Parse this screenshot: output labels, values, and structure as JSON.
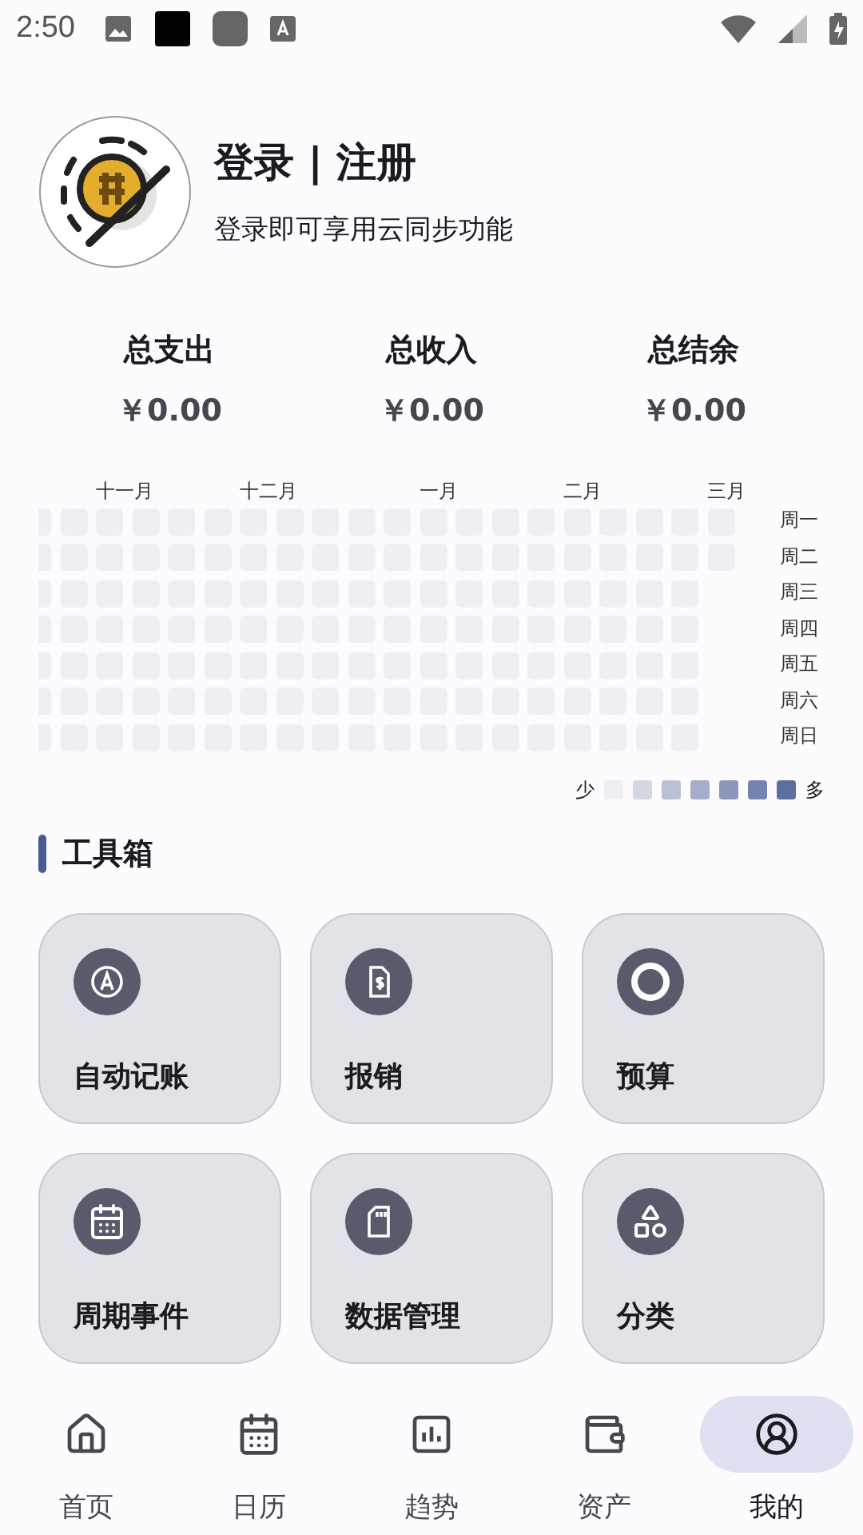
{
  "status_bar": {
    "time": "2:50"
  },
  "profile": {
    "title": "登录 | 注册",
    "subtitle": "登录即可享用云同步功能"
  },
  "totals": [
    {
      "label": "总支出",
      "value": "￥0.00"
    },
    {
      "label": "总收入",
      "value": "￥0.00"
    },
    {
      "label": "总结余",
      "value": "￥0.00"
    }
  ],
  "heatmap": {
    "weekdays": [
      "周一",
      "周二",
      "周三",
      "周四",
      "周五",
      "周六",
      "周日"
    ],
    "weeks": [
      {
        "days": [
          {
            "color": "#efeef4"
          },
          {
            "color": "#efeef4"
          },
          {
            "color": "#efeef4"
          },
          {
            "color": "#efeef4"
          },
          {
            "color": "#efeef4"
          },
          {
            "color": "#efeef4"
          },
          {
            "color": "#efeef4"
          }
        ]
      },
      {
        "days": [
          {
            "color": "#efeef4"
          },
          {
            "color": "#efeef4"
          },
          {
            "color": "#efeef4"
          },
          {
            "color": "#efeef4"
          },
          {
            "color": "#efeef4"
          },
          {
            "color": "#efeef4"
          },
          {
            "color": "#efeef4"
          }
        ]
      },
      {
        "month": "十一月",
        "days": [
          {
            "color": "#efeef4"
          },
          {
            "color": "#efeef4"
          },
          {
            "color": "#efeef4"
          },
          {
            "color": "#efeef4"
          },
          {
            "color": "#efeef4"
          },
          {
            "color": "#efeef4"
          },
          {
            "color": "#efeef4"
          }
        ]
      },
      {
        "days": [
          {
            "color": "#efeef4"
          },
          {
            "color": "#efeef4"
          },
          {
            "color": "#efeef4"
          },
          {
            "color": "#efeef4"
          },
          {
            "color": "#efeef4"
          },
          {
            "color": "#efeef4"
          },
          {
            "color": "#efeef4"
          }
        ]
      },
      {
        "days": [
          {
            "color": "#efeef4"
          },
          {
            "color": "#efeef4"
          },
          {
            "color": "#efeef4"
          },
          {
            "color": "#efeef4"
          },
          {
            "color": "#efeef4"
          },
          {
            "color": "#efeef4"
          },
          {
            "color": "#efeef4"
          }
        ]
      },
      {
        "days": [
          {
            "color": "#efeef4"
          },
          {
            "color": "#efeef4"
          },
          {
            "color": "#efeef4"
          },
          {
            "color": "#efeef4"
          },
          {
            "color": "#efeef4"
          },
          {
            "color": "#efeef4"
          },
          {
            "color": "#efeef4"
          }
        ]
      },
      {
        "month": "十二月",
        "days": [
          {
            "color": "#efeef4"
          },
          {
            "color": "#efeef4"
          },
          {
            "color": "#efeef4"
          },
          {
            "color": "#efeef4"
          },
          {
            "color": "#efeef4"
          },
          {
            "color": "#efeef4"
          },
          {
            "color": "#efeef4"
          }
        ]
      },
      {
        "days": [
          {
            "color": "#efeef4"
          },
          {
            "color": "#efeef4"
          },
          {
            "color": "#efeef4"
          },
          {
            "color": "#efeef4"
          },
          {
            "color": "#efeef4"
          },
          {
            "color": "#efeef4"
          },
          {
            "color": "#efeef4"
          }
        ]
      },
      {
        "days": [
          {
            "color": "#efeef4"
          },
          {
            "color": "#efeef4"
          },
          {
            "color": "#efeef4"
          },
          {
            "color": "#efeef4"
          },
          {
            "color": "#efeef4"
          },
          {
            "color": "#efeef4"
          },
          {
            "color": "#efeef4"
          }
        ]
      },
      {
        "days": [
          {
            "color": "#efeef4"
          },
          {
            "color": "#efeef4"
          },
          {
            "color": "#efeef4"
          },
          {
            "color": "#efeef4"
          },
          {
            "color": "#efeef4"
          },
          {
            "color": "#efeef4"
          },
          {
            "color": "#efeef4"
          }
        ]
      },
      {
        "days": [
          {
            "color": "#efeef4"
          },
          {
            "color": "#efeef4"
          },
          {
            "color": "#efeef4"
          },
          {
            "color": "#efeef4"
          },
          {
            "color": "#efeef4"
          },
          {
            "color": "#efeef4"
          },
          {
            "color": "#efeef4"
          }
        ]
      },
      {
        "month": "一月",
        "days": [
          {
            "color": "#efeef4"
          },
          {
            "color": "#efeef4"
          },
          {
            "color": "#efeef4"
          },
          {
            "color": "#efeef4"
          },
          {
            "color": "#efeef4"
          },
          {
            "color": "#efeef4"
          },
          {
            "color": "#efeef4"
          }
        ]
      },
      {
        "days": [
          {
            "color": "#efeef4"
          },
          {
            "color": "#efeef4"
          },
          {
            "color": "#efeef4"
          },
          {
            "color": "#efeef4"
          },
          {
            "color": "#efeef4"
          },
          {
            "color": "#efeef4"
          },
          {
            "color": "#efeef4"
          }
        ]
      },
      {
        "days": [
          {
            "color": "#efeef4"
          },
          {
            "color": "#efeef4"
          },
          {
            "color": "#efeef4"
          },
          {
            "color": "#efeef4"
          },
          {
            "color": "#efeef4"
          },
          {
            "color": "#efeef4"
          },
          {
            "color": "#efeef4"
          }
        ]
      },
      {
        "days": [
          {
            "color": "#efeef4"
          },
          {
            "color": "#efeef4"
          },
          {
            "color": "#efeef4"
          },
          {
            "color": "#efeef4"
          },
          {
            "color": "#efeef4"
          },
          {
            "color": "#efeef4"
          },
          {
            "color": "#efeef4"
          }
        ]
      },
      {
        "month": "二月",
        "days": [
          {
            "color": "#efeef4"
          },
          {
            "color": "#efeef4"
          },
          {
            "color": "#efeef4"
          },
          {
            "color": "#efeef4"
          },
          {
            "color": "#efeef4"
          },
          {
            "color": "#efeef4"
          },
          {
            "color": "#efeef4"
          }
        ]
      },
      {
        "days": [
          {
            "color": "#efeef4"
          },
          {
            "color": "#efeef4"
          },
          {
            "color": "#efeef4"
          },
          {
            "color": "#efeef4"
          },
          {
            "color": "#efeef4"
          },
          {
            "color": "#efeef4"
          },
          {
            "color": "#efeef4"
          }
        ]
      },
      {
        "days": [
          {
            "color": "#efeef4"
          },
          {
            "color": "#efeef4"
          },
          {
            "color": "#efeef4"
          },
          {
            "color": "#efeef4"
          },
          {
            "color": "#efeef4"
          },
          {
            "color": "#efeef4"
          },
          {
            "color": "#efeef4"
          }
        ]
      },
      {
        "days": [
          {
            "color": "#efeef4"
          },
          {
            "color": "#efeef4"
          },
          {
            "color": "#efeef4"
          },
          {
            "color": "#efeef4"
          },
          {
            "color": "#efeef4"
          },
          {
            "color": "#efeef4"
          },
          {
            "color": "#efeef4"
          }
        ]
      },
      {
        "month": "三月",
        "days": [
          {
            "color": "#efeef4"
          },
          {
            "color": "#efeef4"
          }
        ]
      }
    ],
    "legend": {
      "low": "少",
      "high": "多",
      "swatches": [
        {
          "color": "#efeef4"
        },
        {
          "color": "#d4d6e4"
        },
        {
          "color": "#bac0d6"
        },
        {
          "color": "#a4adc9"
        },
        {
          "color": "#8c98bb"
        },
        {
          "color": "#7584ae"
        },
        {
          "color": "#5c6fa0"
        }
      ]
    }
  },
  "toolbox": {
    "title": "工具箱",
    "tools": [
      {
        "label": "自动记账"
      },
      {
        "label": "报销"
      },
      {
        "label": "预算"
      },
      {
        "label": "周期事件"
      },
      {
        "label": "数据管理"
      },
      {
        "label": "分类"
      }
    ]
  },
  "nav": [
    {
      "label": "首页",
      "selected": false
    },
    {
      "label": "日历",
      "selected": false
    },
    {
      "label": "趋势",
      "selected": false
    },
    {
      "label": "资产",
      "selected": false
    },
    {
      "label": "我的",
      "selected": true
    }
  ]
}
